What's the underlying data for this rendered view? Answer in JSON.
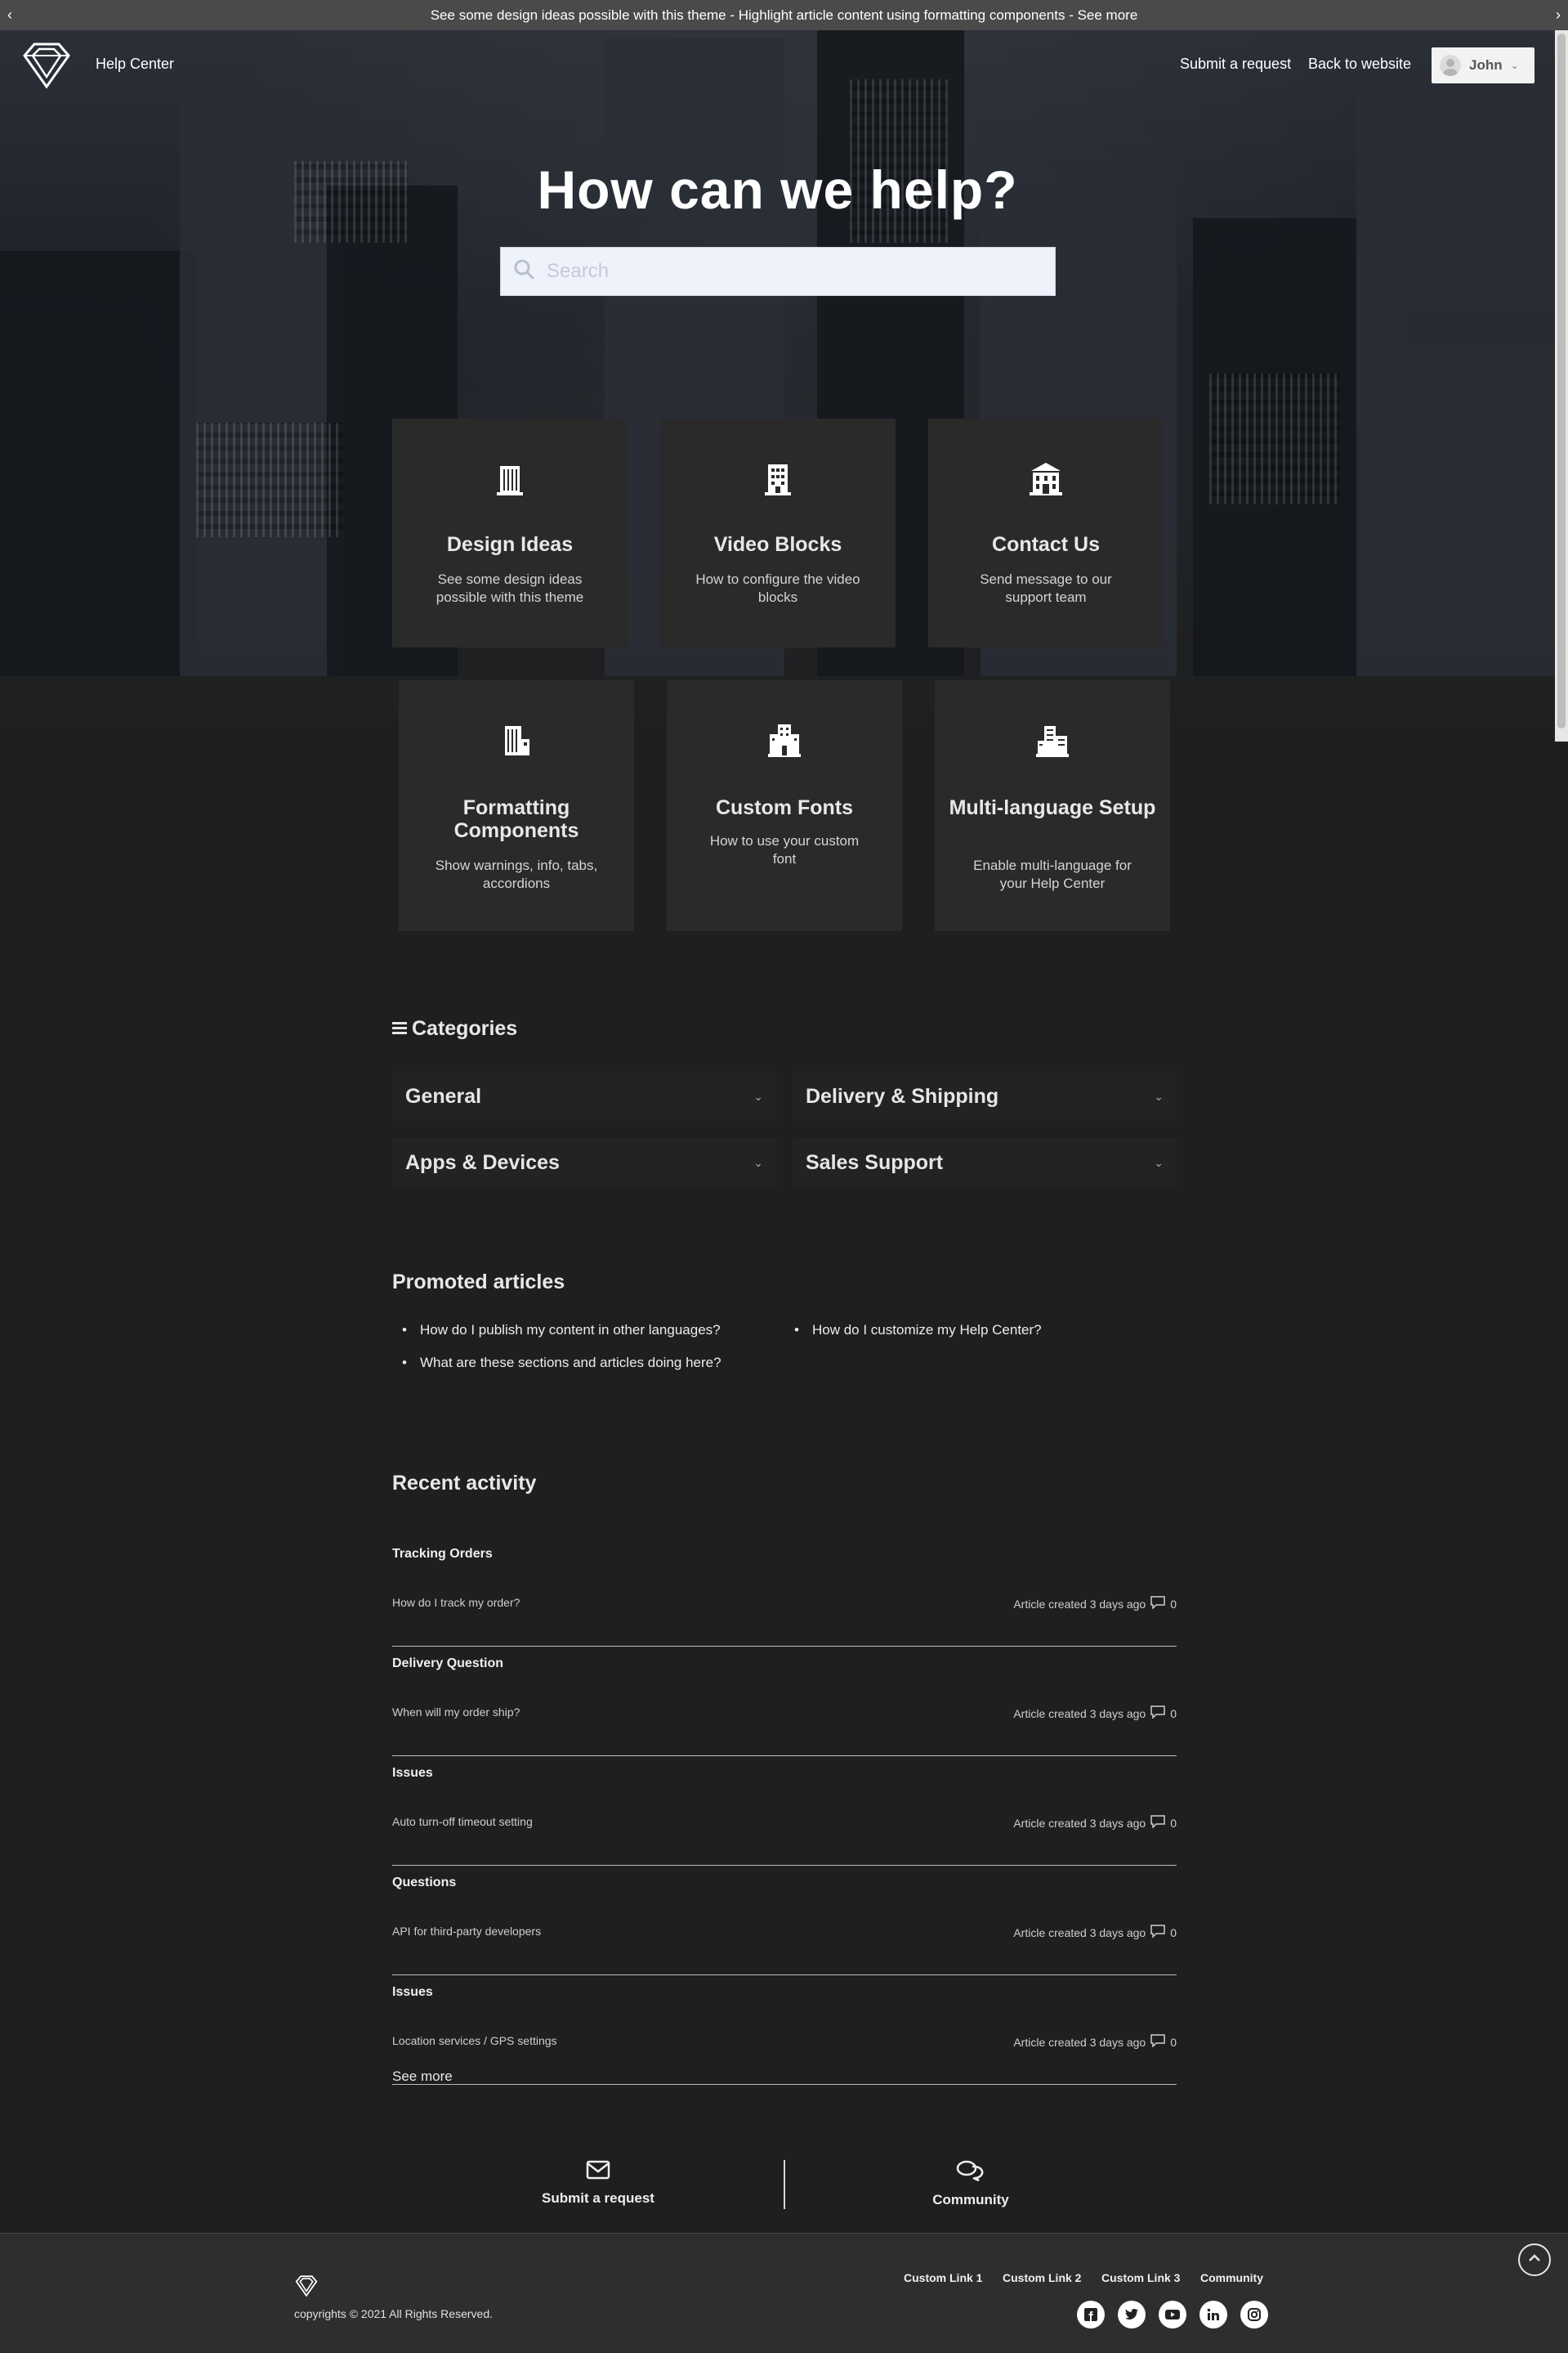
{
  "announcement": {
    "text": "See some design ideas possible with this theme - Highlight article content using formatting components - See more",
    "prev_arrow": "‹",
    "next_arrow": "›"
  },
  "header": {
    "logo_icon": "diamond-logo-icon",
    "help_center_label": "Help Center",
    "submit_request": "Submit a request",
    "back_to_website": "Back to website",
    "user_name": "John",
    "user_caret": "⌄"
  },
  "hero": {
    "title": "How can we help?",
    "search_placeholder": "Search"
  },
  "cards": [
    {
      "icon": "building-icon",
      "title": "Design Ideas",
      "desc": "See some design ideas possible with this theme"
    },
    {
      "icon": "office-building-icon",
      "title": "Video Blocks",
      "desc": "How to configure the video blocks"
    },
    {
      "icon": "bank-building-icon",
      "title": "Contact Us",
      "desc": "Send message to our support team"
    },
    {
      "icon": "tower-building-icon",
      "title": "Formatting Components",
      "desc": "Show warnings, info, tabs, accordions"
    },
    {
      "icon": "city-building-icon",
      "title": "Custom Fonts",
      "desc": "How to use your custom font"
    },
    {
      "icon": "complex-building-icon",
      "title": "Multi-language Setup",
      "desc": "Enable multi-language for your Help Center"
    }
  ],
  "categories": {
    "heading": "Categories",
    "items": [
      {
        "label": "General"
      },
      {
        "label": "Delivery & Shipping"
      },
      {
        "label": "Apps & Devices"
      },
      {
        "label": "Sales Support"
      }
    ],
    "chevron": "⌄"
  },
  "promoted": {
    "heading": "Promoted articles",
    "items": [
      "How do I publish my content in other languages?",
      "How do I customize my Help Center?",
      "What are these sections and articles doing here?"
    ]
  },
  "recent": {
    "heading": "Recent activity",
    "items": [
      {
        "parent": "Tracking Orders",
        "article": "How do I track my order?",
        "meta": "Article created 3 days ago",
        "comments": "0"
      },
      {
        "parent": "Delivery Question",
        "article": "When will my order ship?",
        "meta": "Article created 3 days ago",
        "comments": "0"
      },
      {
        "parent": "Issues",
        "article": "Auto turn-off timeout setting",
        "meta": "Article created 3 days ago",
        "comments": "0"
      },
      {
        "parent": "Questions",
        "article": "API for third-party developers",
        "meta": "Article created 3 days ago",
        "comments": "0"
      },
      {
        "parent": "Issues",
        "article": "Location services / GPS settings",
        "meta": "Article created 3 days ago",
        "comments": "0"
      }
    ],
    "see_more": "See more"
  },
  "bottom_links": {
    "submit": "Submit a request",
    "community": "Community"
  },
  "footer": {
    "copyright": "copyrights © 2021 All Rights Reserved.",
    "links": [
      "Custom Link 1",
      "Custom Link 2",
      "Custom Link 3",
      "Community"
    ],
    "social": [
      "facebook-icon",
      "twitter-icon",
      "youtube-icon",
      "linkedin-icon",
      "instagram-icon"
    ]
  },
  "colors": {
    "page_bg": "#1f1f1f",
    "card_bg": "#2a2a2a",
    "announcement_bg": "#4a4a4a",
    "footer_bg": "#2e2e2e"
  }
}
